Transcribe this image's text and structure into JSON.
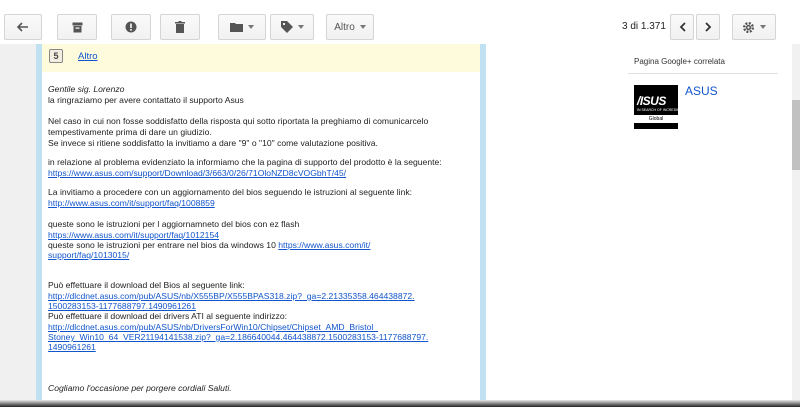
{
  "toolbar": {
    "more_label": "Altro",
    "counter": "3 di 1.371",
    "icons": [
      "back-arrow-icon",
      "archive-icon",
      "spam-icon",
      "trash-icon",
      "folder-icon",
      "label-icon",
      "chevron-left-icon",
      "chevron-right-icon",
      "gear-icon"
    ]
  },
  "message": {
    "badge": "5",
    "altro_link": "Altro",
    "lines": {
      "l1": "Gentile sig. Lorenzo",
      "l2": "la ringraziamo per avere contattato il supporto Asus",
      "l3": "Nel caso in cui non fosse soddisfatto della risposta qui sotto riportata la preghiamo di comunicarcelo",
      "l4": "tempestivamente prima di dare un giudizio.",
      "l5": "Se invece si ritiene soddisfatto la invitiamo a dare \"9\" o \"10\" come valutazione positiva.",
      "l6": "in relazione al problema evidenziato la informiamo che la pagina di supporto del prodotto è la seguente:",
      "l7": "https://www.asus.com/support/Download/3/663/0/26/71OloNZD8cVOGbhT/45/",
      "l8": "La invitiamo a procedere con un aggiornamento del bios  seguendo le istruzioni al seguente link:",
      "l9": "http://www.asus.com/it/support/faq/1008859",
      "l10": "queste sono le istruzioni per l aggiornamneto del bios con ez flash",
      "l11": "https://www.asus.com/it/support/faq/1012154",
      "l12a": "queste sono le istruzioni per entrare nel bios da windows 10  ",
      "l12b": "https://www.asus.com/it/",
      "l13": "support/faq/1013015/",
      "l14": "Può effettuare il download del Bios al seguente link:",
      "l15": "http://dlcdnet.asus.com/pub/ASUS/nb/X555BP/X555BPAS318.zip?_ga=2.21335358.464438872.",
      "l16": "1500283153-1177688797.1490961261",
      "l17": "Può effettuare il download dei drivers ATI al seguente indirizzo:",
      "l18": "http://dlcdnet.asus.com/pub/ASUS/nb/DriversForWin10/Chipset/Chipset_AMD_Bristol_",
      "l19": "Stoney_Win10_64_VER21194141538.zip?_ga=2.186640044.464438872.1500283153-1177688797.",
      "l20": "1490961261",
      "l21": "Cogliamo l'occasione per porgere cordiali Saluti."
    }
  },
  "sidebar": {
    "google_label": "Pagina Google+ correlata",
    "brand_name": "ASUS",
    "logo_text": "/ISUS",
    "logo_tagline": "IN SEARCH OF INCREDIBLE",
    "logo_region": "Global"
  }
}
